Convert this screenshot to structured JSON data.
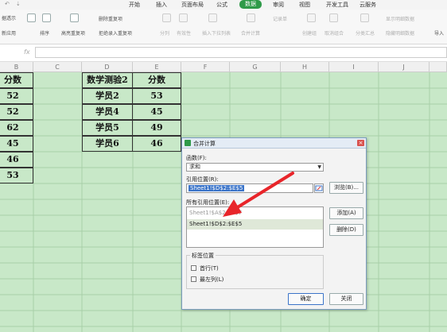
{
  "menu": {
    "quick_access": [
      "↶",
      "⇣"
    ],
    "tabs": [
      "开始",
      "插入",
      "页面布局",
      "公式",
      "数据",
      "审阅",
      "视图",
      "开发工具",
      "云服务"
    ],
    "active_tab": "数据"
  },
  "ribbon": {
    "left_top": "据透示",
    "left_bottom": "新应用",
    "sort": "排序",
    "highlight_dup": "高亮重复项",
    "delete_dup": "删除重复项",
    "reject_dup": "拒绝录入重复项",
    "split": "分列",
    "validity": "有效性",
    "insert_dropdown": "插入下拉列表",
    "consolidate": "合并计算",
    "record_sheet": "记录单",
    "create_group": "创建组",
    "ungroup": "取消组合",
    "subtotal": "分类汇总",
    "show_detail": "显示明细数据",
    "hide_detail": "隐藏明细数据",
    "import": "导入"
  },
  "formula_bar": {
    "fx": "fx",
    "value": ""
  },
  "columns": [
    "B",
    "C",
    "D",
    "E",
    "F",
    "G",
    "H",
    "I",
    "J"
  ],
  "left_table": {
    "header": "分数",
    "values": [
      "52",
      "52",
      "62",
      "45",
      "46",
      "53"
    ]
  },
  "right_table": {
    "headers": [
      "数学测验2",
      "分数"
    ],
    "rows": [
      [
        "学员2",
        "53"
      ],
      [
        "学员4",
        "45"
      ],
      [
        "学员5",
        "49"
      ],
      [
        "学员6",
        "46"
      ]
    ]
  },
  "dialog": {
    "title": "合并计算",
    "close": "×",
    "function_label": "函数(F):",
    "function_value": "求和",
    "ref_label": "引用位置(R):",
    "ref_value": "Sheet1!$D$2:$E$5",
    "browse": "浏览(B)...",
    "all_refs_label": "所有引用位置(E):",
    "all_refs": [
      "Sheet1!$A$2:$B$7",
      "Sheet1!$D$2:$E$5"
    ],
    "add": "添加(A)",
    "delete": "删除(D)",
    "label_group": "标签位置",
    "first_row": "首行(T)",
    "left_col": "最左列(L)",
    "ok": "确定",
    "close_btn": "关闭"
  },
  "colors": {
    "accent": "#2f9a49",
    "sheet_bg": "#c8e8c8",
    "arrow": "#e8252a",
    "selection": "#3b74c9"
  }
}
